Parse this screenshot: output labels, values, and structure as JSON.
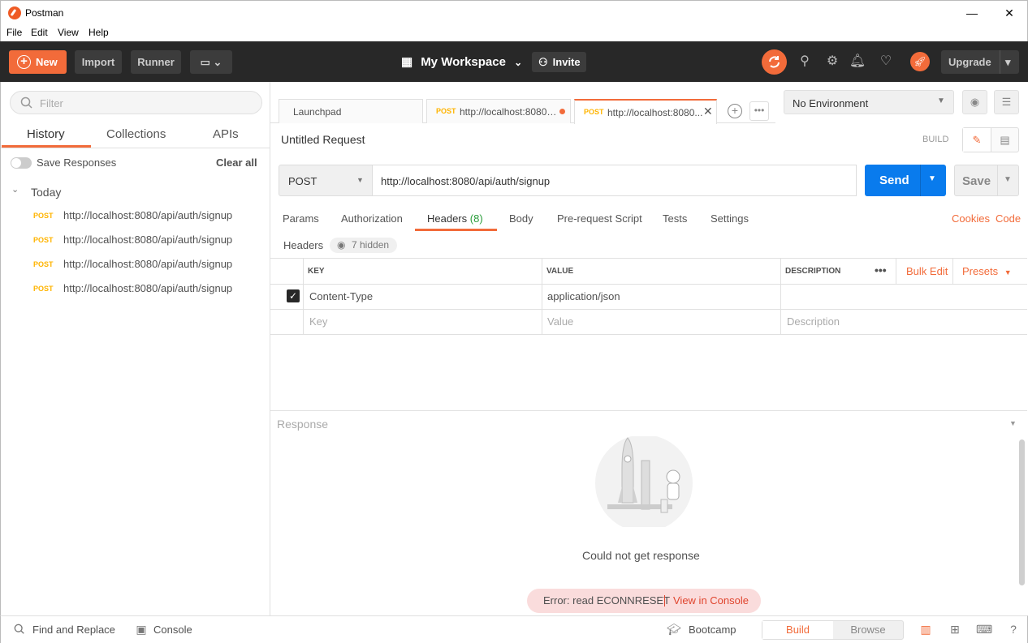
{
  "window": {
    "title": "Postman",
    "minimize": "—",
    "maximize": "☐",
    "close": "✕"
  },
  "menu": [
    "File",
    "Edit",
    "View",
    "Help"
  ],
  "toolbar": {
    "new_label": "New",
    "import_label": "Import",
    "runner_label": "Runner",
    "workspace_label": "My Workspace",
    "invite_label": "Invite",
    "upgrade_label": "Upgrade"
  },
  "sidebar": {
    "filter_placeholder": "Filter",
    "tabs": [
      "History",
      "Collections",
      "APIs"
    ],
    "save_responses_label": "Save Responses",
    "clear_all_label": "Clear all",
    "group_label": "Today",
    "history": [
      {
        "method": "POST",
        "url": "http://localhost:8080/api/auth/signup"
      },
      {
        "method": "POST",
        "url": "http://localhost:8080/api/auth/signup"
      },
      {
        "method": "POST",
        "url": "http://localhost:8080/api/auth/signup"
      },
      {
        "method": "POST",
        "url": "http://localhost:8080/api/auth/signup"
      }
    ]
  },
  "tabs": [
    {
      "label": "Launchpad"
    },
    {
      "method": "POST",
      "label": "http://localhost:8080/..."
    },
    {
      "method": "POST",
      "label": "http://localhost:8080..."
    }
  ],
  "environment": {
    "label": "No Environment"
  },
  "request": {
    "title": "Untitled Request",
    "build_label": "BUILD",
    "method": "POST",
    "url": "http://localhost:8080/api/auth/signup",
    "send_label": "Send",
    "save_label": "Save",
    "subtabs": [
      "Params",
      "Authorization",
      "Headers",
      "Body",
      "Pre-request Script",
      "Tests",
      "Settings"
    ],
    "headers_count": "(8)",
    "cookies_label": "Cookies",
    "code_label": "Code",
    "headers_label": "Headers",
    "hidden_label": "7 hidden"
  },
  "headers_table": {
    "columns": [
      "KEY",
      "VALUE",
      "DESCRIPTION"
    ],
    "bulk_edit_label": "Bulk Edit",
    "presets_label": "Presets",
    "rows": [
      {
        "checked": true,
        "key": "Content-Type",
        "value": "application/json",
        "description": ""
      }
    ],
    "placeholders": {
      "key": "Key",
      "value": "Value",
      "description": "Description"
    }
  },
  "response": {
    "label": "Response",
    "message": "Could not get response",
    "error_text": "Error: read ECONNRESET",
    "console_link": "View in Console"
  },
  "statusbar": {
    "find_replace": "Find and Replace",
    "console": "Console",
    "bootcamp": "Bootcamp",
    "build": "Build",
    "browse": "Browse"
  },
  "colors": {
    "accent": "#f26b3a",
    "send": "#097bed",
    "method_post": "#ffb400"
  }
}
